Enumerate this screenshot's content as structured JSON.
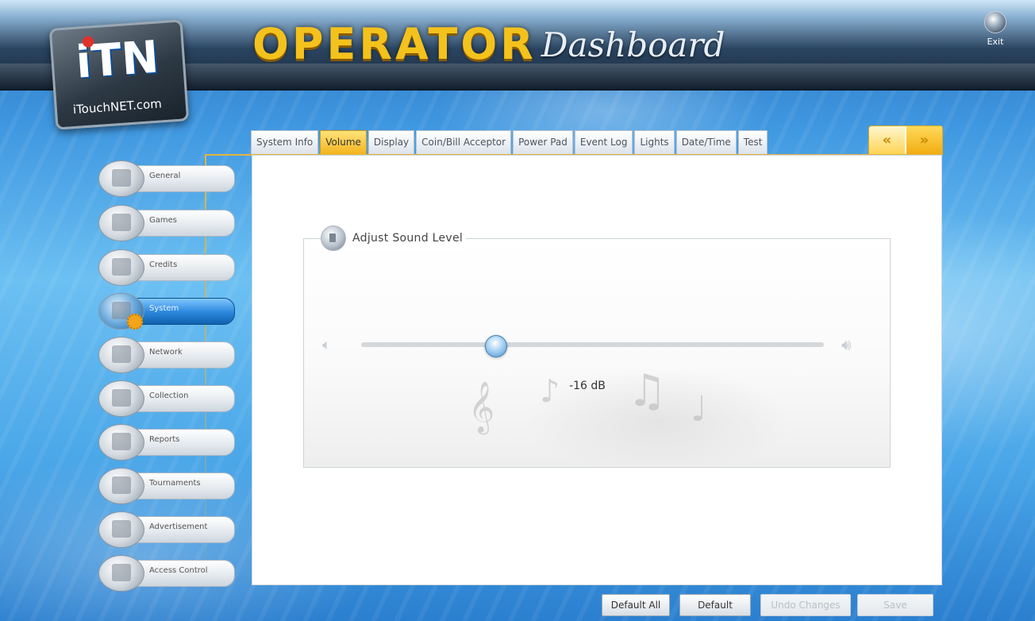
{
  "app": {
    "title_main": "OPERATOR",
    "title_sub": "Dashboard",
    "logo_text": "iTN",
    "logo_name": "iTouchNET.com",
    "exit_label": "Exit"
  },
  "tabs": {
    "items": [
      "System Info",
      "Volume",
      "Display",
      "Coin/Bill Acceptor",
      "Power Pad",
      "Event Log",
      "Lights",
      "Date/Time",
      "Test"
    ],
    "active": "Volume",
    "prev_label": "«",
    "next_label": "»"
  },
  "sidebar": {
    "items": [
      {
        "label": "General",
        "icon": "cabinet-icon"
      },
      {
        "label": "Games",
        "icon": "joystick-icon"
      },
      {
        "label": "Credits",
        "icon": "credits-icon"
      },
      {
        "label": "System",
        "icon": "monitor-gear-icon"
      },
      {
        "label": "Network",
        "icon": "network-icon"
      },
      {
        "label": "Collection",
        "icon": "money-bag-icon"
      },
      {
        "label": "Reports",
        "icon": "report-icon"
      },
      {
        "label": "Tournaments",
        "icon": "trophy-icon"
      },
      {
        "label": "Advertisement",
        "icon": "advertisement-icon"
      },
      {
        "label": "Access Control",
        "icon": "keypad-icon"
      }
    ],
    "active": "System"
  },
  "volume": {
    "group_title": "Adjust Sound Level",
    "level_text": "-16 dB",
    "slider_fraction": 0.29,
    "low_icon": "speaker-low-icon",
    "high_icon": "speaker-high-icon"
  },
  "footer": {
    "default_all": "Default All",
    "default": "Default",
    "undo": "Undo Changes",
    "save": "Save"
  },
  "colors": {
    "accent_gold": "#f3b520",
    "active_blue": "#2a86dc",
    "background_blue": "#3f97e0"
  }
}
